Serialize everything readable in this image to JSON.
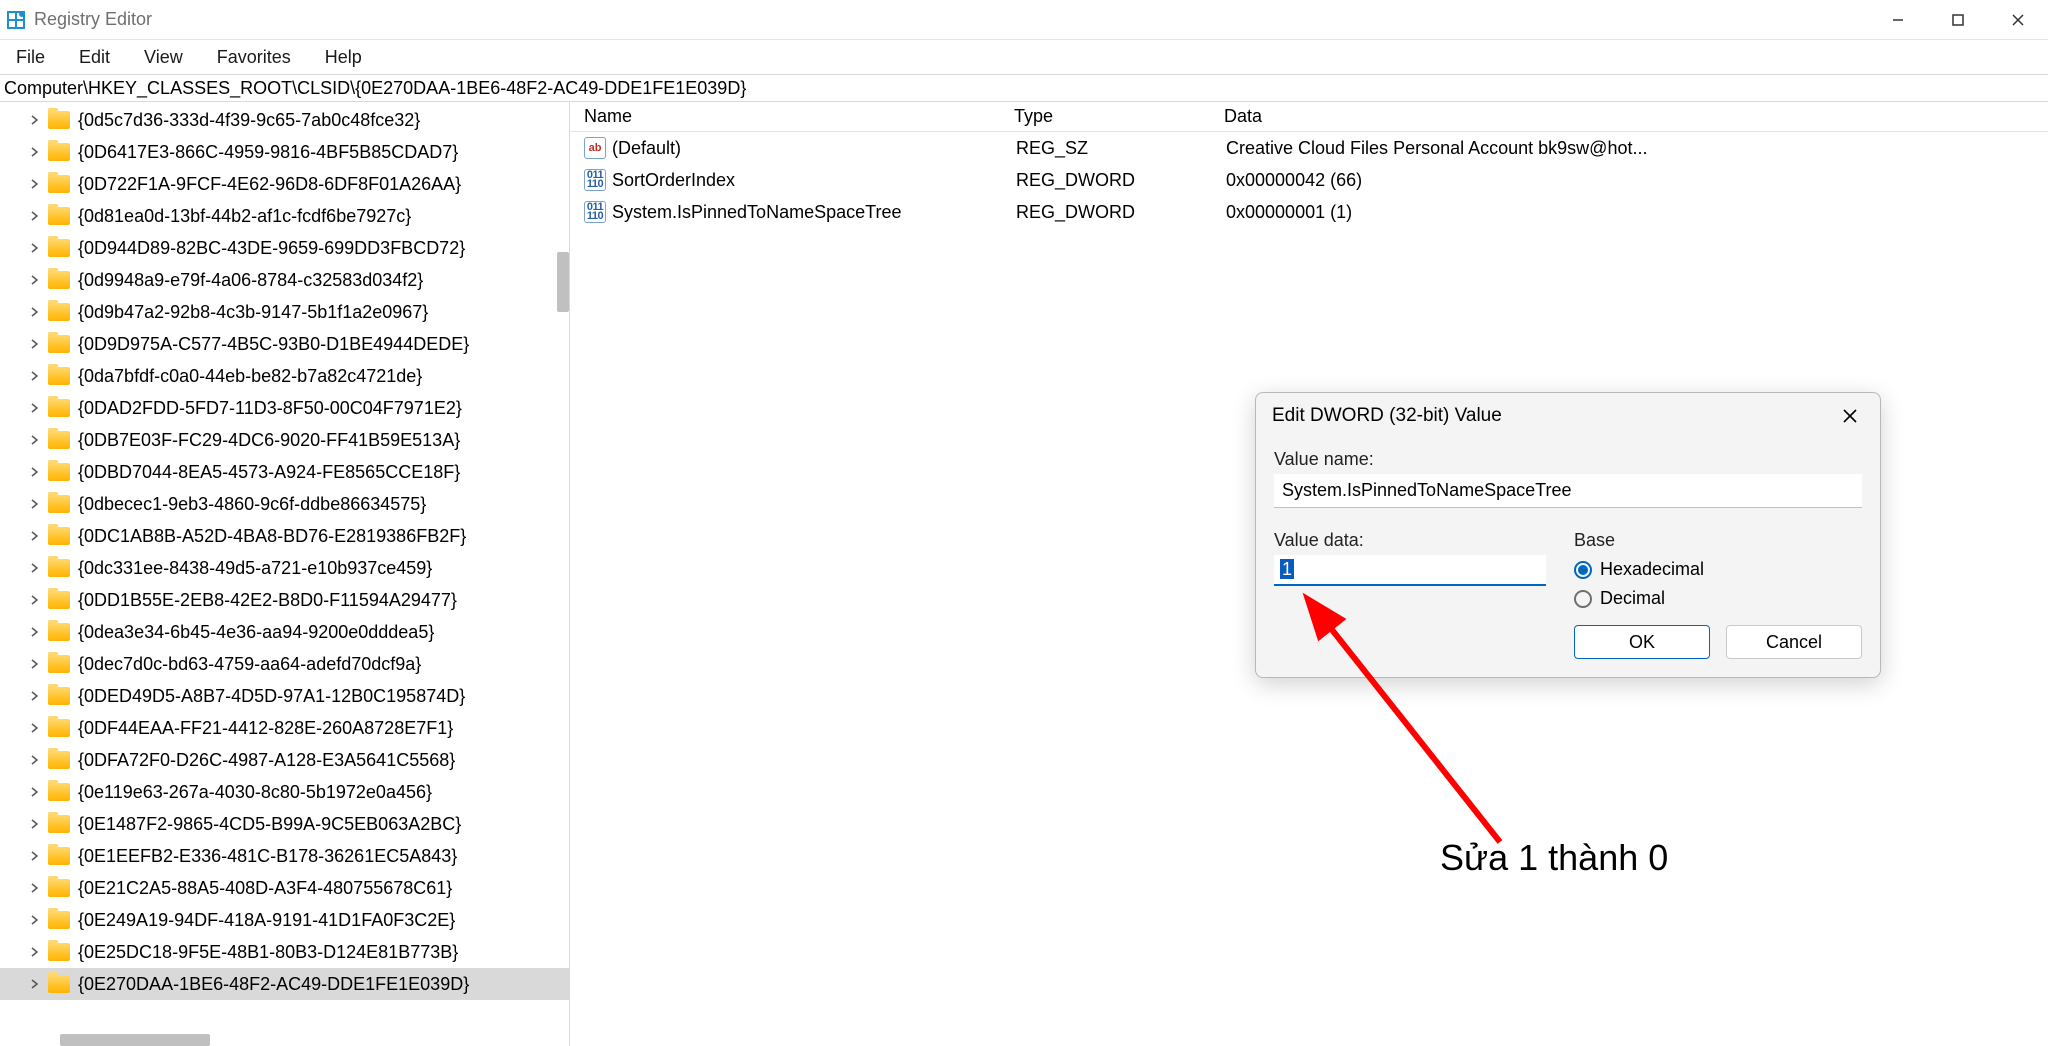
{
  "window": {
    "title": "Registry Editor",
    "controls": {
      "min": "–",
      "max": "▢",
      "close": "✕"
    }
  },
  "menu": {
    "file": "File",
    "edit": "Edit",
    "view": "View",
    "favorites": "Favorites",
    "help": "Help"
  },
  "address": "Computer\\HKEY_CLASSES_ROOT\\CLSID\\{0E270DAA-1BE6-48F2-AC49-DDE1FE1E039D}",
  "tree": [
    "{0d5c7d36-333d-4f39-9c65-7ab0c48fce32}",
    "{0D6417E3-866C-4959-9816-4BF5B85CDAD7}",
    "{0D722F1A-9FCF-4E62-96D8-6DF8F01A26AA}",
    "{0d81ea0d-13bf-44b2-af1c-fcdf6be7927c}",
    "{0D944D89-82BC-43DE-9659-699DD3FBCD72}",
    "{0d9948a9-e79f-4a06-8784-c32583d034f2}",
    "{0d9b47a2-92b8-4c3b-9147-5b1f1a2e0967}",
    "{0D9D975A-C577-4B5C-93B0-D1BE4944DEDE}",
    "{0da7bfdf-c0a0-44eb-be82-b7a82c4721de}",
    "{0DAD2FDD-5FD7-11D3-8F50-00C04F7971E2}",
    "{0DB7E03F-FC29-4DC6-9020-FF41B59E513A}",
    "{0DBD7044-8EA5-4573-A924-FE8565CCE18F}",
    "{0dbecec1-9eb3-4860-9c6f-ddbe86634575}",
    "{0DC1AB8B-A52D-4BA8-BD76-E2819386FB2F}",
    "{0dc331ee-8438-49d5-a721-e10b937ce459}",
    "{0DD1B55E-2EB8-42E2-B8D0-F11594A29477}",
    "{0dea3e34-6b45-4e36-aa94-9200e0dddea5}",
    "{0dec7d0c-bd63-4759-aa64-adefd70dcf9a}",
    "{0DED49D5-A8B7-4D5D-97A1-12B0C195874D}",
    "{0DF44EAA-FF21-4412-828E-260A8728E7F1}",
    "{0DFA72F0-D26C-4987-A128-E3A5641C5568}",
    "{0e119e63-267a-4030-8c80-5b1972e0a456}",
    "{0E1487F2-9865-4CD5-B99A-9C5EB063A2BC}",
    "{0E1EEFB2-E336-481C-B178-36261EC5A843}",
    "{0E21C2A5-88A5-408D-A3F4-480755678C61}",
    "{0E249A19-94DF-418A-9191-41D1FA0F3C2E}",
    "{0E25DC18-9F5E-48B1-80B3-D124E81B773B}",
    "{0E270DAA-1BE6-48F2-AC49-DDE1FE1E039D}"
  ],
  "tree_selected_index": 27,
  "list": {
    "headers": {
      "name": "Name",
      "type": "Type",
      "data": "Data"
    },
    "rows": [
      {
        "icon": "str",
        "name": "(Default)",
        "type": "REG_SZ",
        "data": "Creative Cloud Files Personal Account bk9sw@hot..."
      },
      {
        "icon": "bin",
        "name": "SortOrderIndex",
        "type": "REG_DWORD",
        "data": "0x00000042 (66)"
      },
      {
        "icon": "bin",
        "name": "System.IsPinnedToNameSpaceTree",
        "type": "REG_DWORD",
        "data": "0x00000001 (1)"
      }
    ]
  },
  "dialog": {
    "title": "Edit DWORD (32-bit) Value",
    "value_name_label": "Value name:",
    "value_name": "System.IsPinnedToNameSpaceTree",
    "value_data_label": "Value data:",
    "value_data": "1",
    "base_label": "Base",
    "hex_label": "Hexadecimal",
    "dec_label": "Decimal",
    "ok": "OK",
    "cancel": "Cancel"
  },
  "annotation": "Sửa 1 thành 0"
}
